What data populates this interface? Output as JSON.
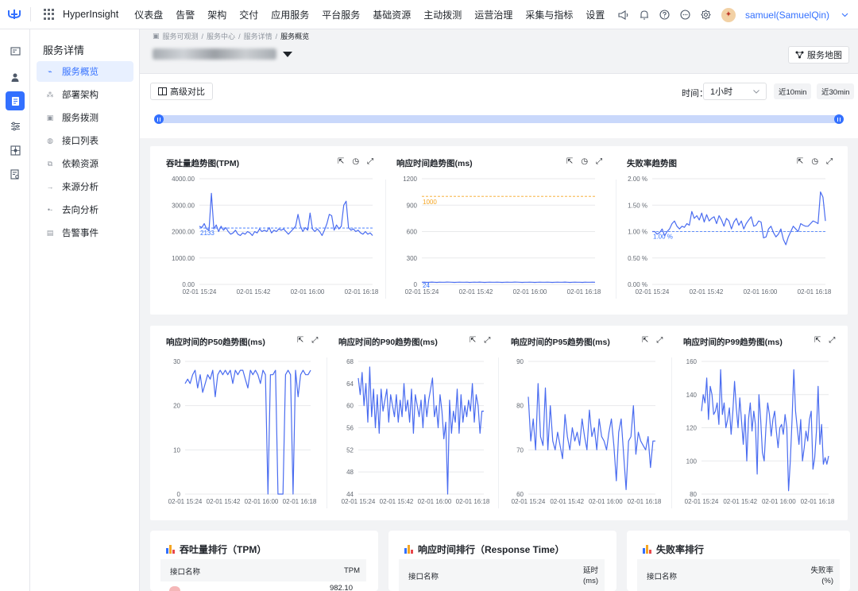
{
  "topbar": {
    "brand": "HyperInsight",
    "nav": [
      "仪表盘",
      "告警",
      "架构",
      "交付",
      "应用服务",
      "平台服务",
      "基础资源",
      "主动拨测",
      "运营治理",
      "采集与指标",
      "设置"
    ],
    "user": "samuel(SamuelQin)",
    "icons": [
      "megaphone-icon",
      "bell-icon",
      "help-icon",
      "chat-icon",
      "gear-icon"
    ]
  },
  "rail": {
    "icons": [
      "dashboard-icon",
      "user-location-icon",
      "service-icon",
      "settings-sliders-icon",
      "topology-icon",
      "report-icon"
    ],
    "active_index": 2
  },
  "menu": {
    "title": "服务详情",
    "items": [
      "服务概览",
      "部署架构",
      "服务拨测",
      "接口列表",
      "依赖资源",
      "来源分析",
      "去向分析",
      "告警事件"
    ],
    "active_index": 0
  },
  "breadcrumb": [
    "服务可观测",
    "服务中心",
    "服务详情",
    "服务概览"
  ],
  "service_map_label": "服务地图",
  "filter": {
    "compare_label": "高级对比",
    "time_label": "时间：",
    "time_value": "1小时",
    "quick_ranges": [
      "近10min",
      "近30min"
    ]
  },
  "charts_row1": [
    {
      "title": "吞吐量趋势图(TPM)",
      "y_ticks": [
        "4000.00",
        "3000.00",
        "2000.00",
        "1000.00",
        "0.00"
      ],
      "x_ticks": [
        "02-01 15:24",
        "02-01 15:42",
        "02-01 16:00",
        "02-01 16:18"
      ],
      "ref_label": "2133"
    },
    {
      "title": "响应时间趋势图(ms)",
      "y_ticks": [
        "1200",
        "900",
        "600",
        "300",
        "0"
      ],
      "x_ticks": [
        "02-01 15:24",
        "02-01 15:42",
        "02-01 16:00",
        "02-01 16:18"
      ],
      "ref_label": "1000",
      "base_label": "24"
    },
    {
      "title": "失败率趋势图",
      "y_ticks": [
        "2.00 %",
        "1.50 %",
        "1.00 %",
        "0.50 %",
        "0.00 %"
      ],
      "x_ticks": [
        "02-01 15:24",
        "02-01 15:42",
        "02-01 16:00",
        "02-01 16:18"
      ],
      "ref_label": "1.00 %"
    }
  ],
  "charts_row2": [
    {
      "title": "响应时间的P50趋势图(ms)",
      "y_ticks": [
        "30",
        "20",
        "10",
        "0"
      ],
      "x_ticks": [
        "02-01 15:24",
        "02-01 15:42",
        "02-01 16:00",
        "02-01 16:18"
      ]
    },
    {
      "title": "响应时间的P90趋势图(ms)",
      "y_ticks": [
        "68",
        "64",
        "60",
        "56",
        "52",
        "48",
        "44"
      ],
      "x_ticks": [
        "02-01 15:24",
        "02-01 15:42",
        "02-01 16:00",
        "02-01 16:18"
      ]
    },
    {
      "title": "响应时间的P95趋势图(ms)",
      "y_ticks": [
        "90",
        "80",
        "70",
        "60"
      ],
      "x_ticks": [
        "02-01 15:24",
        "02-01 15:42",
        "02-01 16:00",
        "02-01 16:18"
      ]
    },
    {
      "title": "响应时间的P99趋势图(ms)",
      "y_ticks": [
        "160",
        "140",
        "120",
        "100",
        "80"
      ],
      "x_ticks": [
        "02-01 15:24",
        "02-01 15:42",
        "02-01 16:00",
        "02-01 16:18"
      ]
    }
  ],
  "chart_data": [
    {
      "type": "line",
      "title": "吞吐量趋势图(TPM)",
      "ylim": [
        0,
        4000
      ],
      "x_range": [
        "02-01 15:24",
        "02-01 16:18"
      ],
      "reference_line": 2133,
      "series": [
        {
          "values": [
            2200,
            2150,
            2300,
            2100,
            2050,
            3450,
            2100,
            2250,
            2000,
            2200,
            2050,
            2150,
            2000,
            1900,
            1950,
            2050,
            1900,
            1850,
            1950,
            1900,
            2000,
            1950,
            1850,
            2000,
            1950,
            2100,
            2000,
            2050,
            2000,
            2150,
            1950,
            2050,
            2000,
            2100,
            2050,
            2100,
            2000,
            1900,
            2000,
            2100,
            2200,
            2650,
            2200,
            2000,
            2150,
            2050,
            2700,
            2100,
            2000,
            2100,
            2000,
            1850,
            2050,
            2300,
            2650,
            2600,
            2050,
            2250,
            2100,
            2200,
            3000,
            3150,
            2150,
            2050,
            2100,
            2000,
            2050,
            1950,
            1900,
            2000,
            1900,
            1950,
            1850
          ]
        }
      ]
    },
    {
      "type": "line",
      "title": "响应时间趋势图(ms)",
      "ylim": [
        0,
        1200
      ],
      "x_range": [
        "02-01 15:24",
        "02-01 16:18"
      ],
      "reference_line": 1000,
      "series": [
        {
          "values": [
            24,
            25,
            23,
            24,
            26,
            24,
            23,
            25,
            24,
            24,
            26,
            25,
            24,
            23,
            24,
            25,
            24,
            24,
            25,
            23,
            24,
            25,
            24,
            26,
            24,
            23,
            24,
            25,
            24,
            24,
            25,
            24,
            23,
            24,
            25,
            24,
            24,
            26,
            25,
            24,
            23,
            24,
            24,
            25,
            24,
            23,
            24,
            25,
            24,
            24,
            25,
            24,
            23,
            24,
            25,
            24,
            24,
            26,
            24,
            23,
            24,
            25,
            24,
            24,
            23,
            25,
            24,
            24,
            25,
            24
          ]
        }
      ]
    },
    {
      "type": "line",
      "title": "失败率趋势图",
      "ylim": [
        0,
        2.0
      ],
      "x_range": [
        "02-01 15:24",
        "02-01 16:18"
      ],
      "reference_line": 1.0,
      "series": [
        {
          "values": [
            1.0,
            1.0,
            0.95,
            0.98,
            1.05,
            0.92,
            1.0,
            1.05,
            1.15,
            1.2,
            1.1,
            1.05,
            1.1,
            1.08,
            1.15,
            1.12,
            1.38,
            1.25,
            1.3,
            1.22,
            1.35,
            1.18,
            1.32,
            1.2,
            1.25,
            1.28,
            1.15,
            1.3,
            1.22,
            1.1,
            1.25,
            1.2,
            1.05,
            1.18,
            1.25,
            1.12,
            1.2,
            1.05,
            1.15,
            1.22,
            1.28,
            1.1,
            1.12,
            1.2,
            1.18,
            0.88,
            0.9,
            1.05,
            1.1,
            0.98,
            0.9,
            0.95,
            1.05,
            0.85,
            0.75,
            0.9,
            1.0,
            1.1,
            1.05,
            1.0,
            1.15,
            1.12,
            1.1,
            1.1,
            1.15,
            1.2,
            1.18,
            1.15,
            1.75,
            1.65,
            1.2
          ]
        }
      ]
    },
    {
      "type": "line",
      "title": "响应时间的P50趋势图(ms)",
      "ylim": [
        0,
        30
      ],
      "x_range": [
        "02-01 15:24",
        "02-01 16:18"
      ],
      "series": [
        {
          "values": [
            25,
            26,
            25,
            27,
            28,
            24,
            27,
            23,
            25,
            27,
            26,
            28,
            22,
            27,
            28,
            27,
            28,
            27,
            28,
            25,
            28,
            27,
            28,
            28,
            26,
            24,
            28,
            27,
            28,
            27,
            25,
            28,
            27,
            0,
            27,
            27,
            28,
            0,
            0,
            0,
            27,
            28,
            27,
            0,
            28,
            22,
            27,
            28,
            27,
            27,
            28
          ]
        }
      ]
    },
    {
      "type": "line",
      "title": "响应时间的P90趋势图(ms)",
      "ylim": [
        44,
        68
      ],
      "x_range": [
        "02-01 15:24",
        "02-01 16:18"
      ],
      "series": [
        {
          "values": [
            65,
            62,
            66,
            60,
            64,
            57,
            67,
            58,
            63,
            56,
            62,
            55,
            63,
            59,
            61,
            63,
            57,
            62,
            60,
            58,
            62,
            57,
            61,
            58,
            64,
            59,
            61,
            57,
            63,
            55,
            62,
            60,
            58,
            61,
            56,
            62,
            58,
            61,
            63,
            65,
            58,
            60,
            56,
            62,
            59,
            54,
            57,
            44,
            61,
            55,
            59,
            57,
            63,
            55,
            62,
            57,
            60,
            58,
            61,
            59,
            64,
            57,
            62,
            60,
            55,
            59,
            59
          ]
        }
      ]
    },
    {
      "type": "line",
      "title": "响应时间的P95趋势图(ms)",
      "ylim": [
        60,
        90
      ],
      "x_range": [
        "02-01 15:24",
        "02-01 16:18"
      ],
      "series": [
        {
          "values": [
            82,
            72,
            77,
            70,
            85,
            73,
            71,
            84,
            70,
            80,
            72,
            70,
            74,
            71,
            68,
            78,
            73,
            70,
            75,
            72,
            74,
            71,
            77,
            73,
            70,
            79,
            73,
            75,
            70,
            77,
            73,
            72,
            70,
            74,
            77,
            71,
            63,
            74,
            77,
            69,
            61,
            72,
            73,
            80,
            69,
            74,
            72,
            71,
            70,
            73,
            66,
            72,
            72
          ]
        }
      ]
    },
    {
      "type": "line",
      "title": "响应时间的P99趋势图(ms)",
      "ylim": [
        80,
        160
      ],
      "x_range": [
        "02-01 15:24",
        "02-01 16:18"
      ],
      "series": [
        {
          "values": [
            130,
            140,
            135,
            150,
            125,
            145,
            140,
            128,
            130,
            135,
            122,
            155,
            128,
            135,
            120,
            125,
            132,
            116,
            130,
            148,
            132,
            120,
            138,
            124,
            110,
            128,
            100,
            125,
            135,
            118,
            130,
            122,
            92,
            140,
            125,
            105,
            100,
            120,
            135,
            128,
            115,
            125,
            130,
            118,
            108,
            120,
            122,
            116,
            128,
            120,
            82,
            100,
            125,
            155,
            130,
            120,
            110,
            125,
            100,
            108,
            118,
            112,
            125,
            130,
            95,
            102,
            118,
            145,
            110,
            122,
            98,
            102,
            98,
            103
          ]
        }
      ]
    }
  ],
  "rankings": [
    {
      "title": "吞吐量排行（TPM）",
      "col1": "接口名称",
      "col2": "TPM",
      "first_value": "982.10"
    },
    {
      "title": "响应时间排行（Response Time）",
      "col1": "接口名称",
      "col2": "延时\n(ms)"
    },
    {
      "title": "失败率排行",
      "col1": "接口名称",
      "col2": "失败率\n(%)"
    }
  ],
  "colors": {
    "accent": "#3370ff",
    "line": "#4a6cf0",
    "ref_orange": "#f5a623",
    "ref_blue": "#3370ff"
  }
}
